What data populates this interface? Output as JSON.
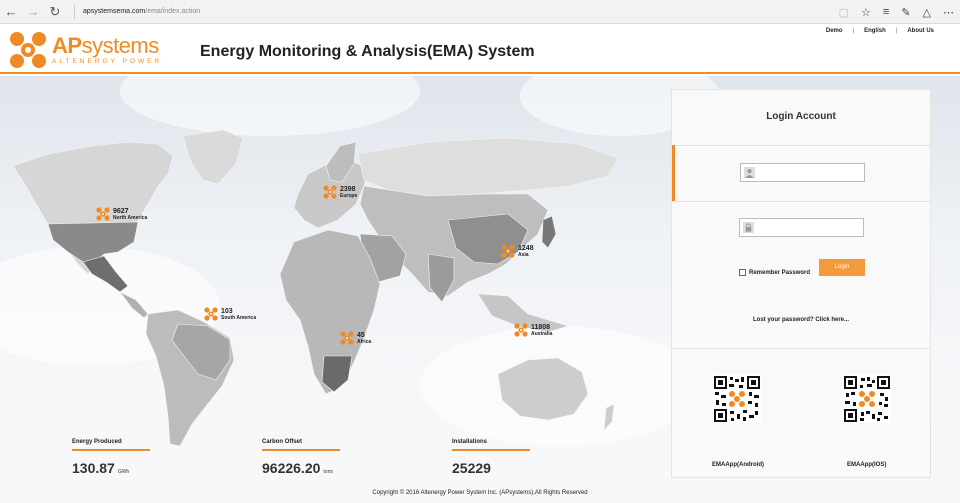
{
  "browser": {
    "url_domain": "apsystemsema.com",
    "url_path": "/ema/index.action"
  },
  "header": {
    "logo_ap": "AP",
    "logo_systems": "systems",
    "logo_tagline": "ALTENERGY POWER",
    "title": "Energy Monitoring & Analysis(EMA) System",
    "links": [
      "Demo",
      "English",
      "About Us"
    ],
    "link_separator": "|"
  },
  "map": {
    "markers": [
      {
        "value": "9627",
        "region": "North America"
      },
      {
        "value": "2398",
        "region": "Europe"
      },
      {
        "value": "1248",
        "region": "Asia"
      },
      {
        "value": "103",
        "region": "South America"
      },
      {
        "value": "45",
        "region": "Africa"
      },
      {
        "value": "11808",
        "region": "Australia"
      }
    ]
  },
  "stats": [
    {
      "label": "Energy Produced",
      "value": "130.87",
      "unit": "GWh"
    },
    {
      "label": "Carbon Offset",
      "value": "96226.20",
      "unit": "tons"
    },
    {
      "label": "Installations",
      "value": "25229",
      "unit": ""
    }
  ],
  "footer": {
    "copyright": "Copyright © 2016 Altenergy Power System Inc. (APsystems),All Rights Reserved"
  },
  "login": {
    "title": "Login Account",
    "username_value": "",
    "password_value": "",
    "remember_label": "Remember Password",
    "remember_checked": false,
    "login_button": "Login",
    "forgot_link": "Lost your password? Click here...",
    "apps": [
      "EMAApp(Android)",
      "EMAApp(IOS)"
    ]
  },
  "colors": {
    "accent": "#f08a24",
    "button": "#f39a3a",
    "land": "#cfcfcf"
  }
}
